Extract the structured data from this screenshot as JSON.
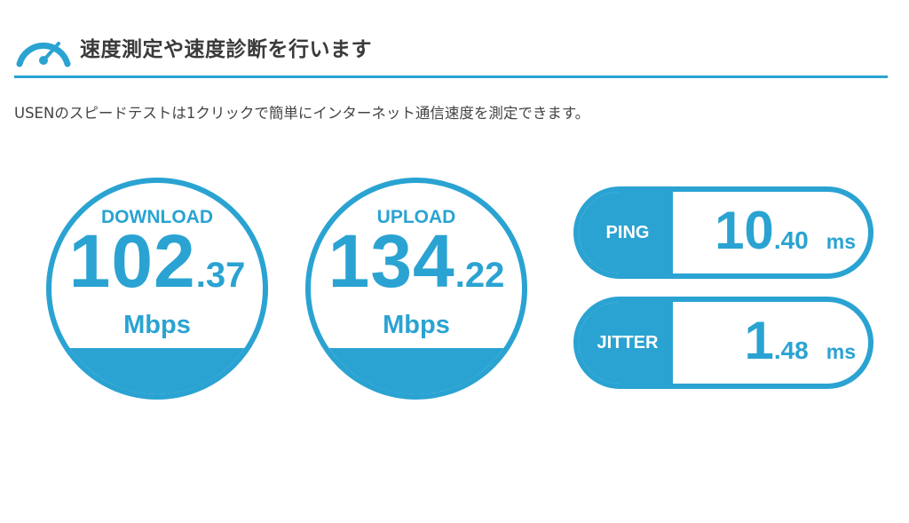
{
  "header": {
    "title": "速度測定や速度診断を行います",
    "icon": "speedometer-icon"
  },
  "intro": "USENのスピードテストは1クリックで簡単にインターネット通信速度を測定できます。",
  "accent_color": "#2aa3d2",
  "download": {
    "label": "DOWNLOAD",
    "integer": "102",
    "decimal": ".37",
    "unit": "Mbps"
  },
  "upload": {
    "label": "UPLOAD",
    "integer": "134",
    "decimal": ".22",
    "unit": "Mbps"
  },
  "ping": {
    "label": "PING",
    "integer": "10",
    "decimal": ".40",
    "unit": "ms"
  },
  "jitter": {
    "label": "JITTER",
    "integer": "1",
    "decimal": ".48",
    "unit": "ms"
  }
}
